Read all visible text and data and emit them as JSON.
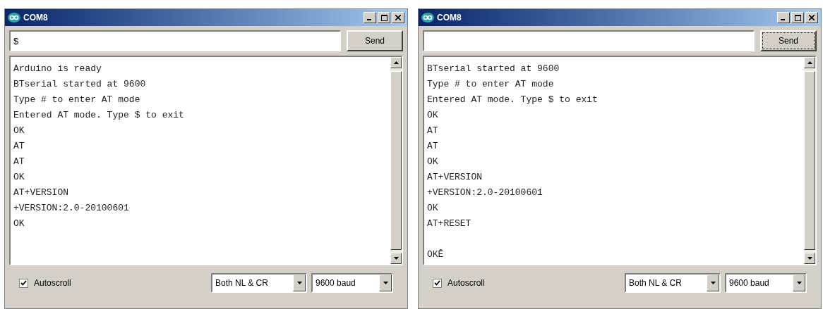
{
  "windows": [
    {
      "title": "COM8",
      "input": {
        "value": "$"
      },
      "send": {
        "label": "Send",
        "focused": false
      },
      "lines": [
        {
          "kind": "text",
          "text": "Arduino is ready"
        },
        {
          "kind": "text",
          "text": "BTserial started at 9600"
        },
        {
          "kind": "text",
          "text": "Type # to enter AT mode"
        },
        {
          "kind": "text",
          "text": "Entered AT mode. Type $ to exit"
        },
        {
          "kind": "text",
          "text": "OK"
        },
        {
          "kind": "text",
          "text": "AT"
        },
        {
          "kind": "text",
          "text": "AT"
        },
        {
          "kind": "text",
          "text": "OK"
        },
        {
          "kind": "text",
          "text": "AT+VERSION"
        },
        {
          "kind": "text",
          "text": "+VERSION:2.0-20100601"
        },
        {
          "kind": "text",
          "text": "OK"
        }
      ],
      "autoscroll": {
        "label": "Autoscroll",
        "checked": true
      },
      "line_ending": "Both NL & CR",
      "baud": "9600 baud"
    },
    {
      "title": "COM8",
      "send": {
        "label": "Send",
        "focused": true
      },
      "lines": [
        {
          "kind": "text",
          "text": "BTserial started at 9600"
        },
        {
          "kind": "text",
          "text": "Type # to enter AT mode"
        },
        {
          "kind": "text",
          "text": "Entered AT mode. Type $ to exit"
        },
        {
          "kind": "text",
          "text": "OK"
        },
        {
          "kind": "text",
          "text": "AT"
        },
        {
          "kind": "text",
          "text": "AT"
        },
        {
          "kind": "text",
          "text": "OK"
        },
        {
          "kind": "text",
          "text": "AT+VERSION"
        },
        {
          "kind": "text",
          "text": "+VERSION:2.0-20100601"
        },
        {
          "kind": "text",
          "text": "OK"
        },
        {
          "kind": "text",
          "text": "AT+RESET"
        },
        {
          "kind": "blank"
        },
        {
          "kind": "text",
          "text": "OKÊ"
        }
      ],
      "autoscroll": {
        "label": "Autoscroll",
        "checked": true
      },
      "line_ending": "Both NL & CR",
      "baud": "9600 baud"
    }
  ]
}
